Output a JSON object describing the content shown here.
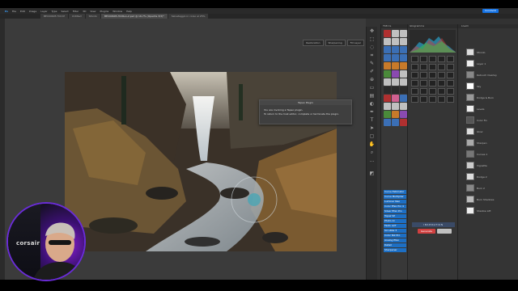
{
  "menu": {
    "items": [
      "Ps",
      "File",
      "Edit",
      "Image",
      "Layer",
      "Type",
      "Select",
      "Filter",
      "3D",
      "View",
      "Plugins",
      "Window",
      "Help"
    ]
  },
  "tabs": [
    {
      "label": "BEC00605 Hdr.tif",
      "active": false
    },
    {
      "label": "Untitled",
      "active": false
    },
    {
      "label": "Sfondo",
      "active": false
    },
    {
      "label": "BEC00605-HdrRun-2.psd @ 16,7% (Opacita 3/3)*",
      "active": true
    },
    {
      "label": "Salvataggio in corso al 25%",
      "active": false
    }
  ],
  "toolbar_right": {
    "share_label": "Condividi"
  },
  "options": {
    "buttons": [
      "Restoration",
      "Sharpening",
      "Fill Layer"
    ]
  },
  "dialog": {
    "title": "Tapeo Plugin",
    "line1": "You are invoking a Tapeo plugin.",
    "line2": "To return to the host editor, complete or terminate the plugin."
  },
  "panels": {
    "tk_header": "TK8 Cs",
    "histogram_header": "Istogramma",
    "tk_list": [
      "Curve Estimator",
      "Curve Multiplier",
      "Luminar Neo",
      "Color Efex Pro 4",
      "Silver Efex Pro",
      "Topaz SP",
      "Photo AI",
      "Fasto AI/T",
      "Scrubba 3",
      "Color Nik Pro",
      "Analog Efex",
      "Detail",
      "Sharpener"
    ],
    "inspiration_label": "INSPIRATION",
    "generate_label": "Generate",
    "layers_tab": "Livelli",
    "layers": [
      "Sfondo",
      "Layer 1",
      "Retouch Overlay",
      "Sky",
      "Dodge & Burn",
      "Levels",
      "Color Fix",
      "Glow",
      "Sharpen",
      "Curves 1",
      "Vignette",
      "Dodge 2",
      "Burn 2",
      "Burn Shadows",
      "Shadow Lift"
    ]
  },
  "overlay": {
    "brand": "corsair"
  },
  "colors": {
    "accent": "#1d6fc4",
    "share_button": "#1473e6",
    "overlay_ring": "#6a2cd8"
  }
}
